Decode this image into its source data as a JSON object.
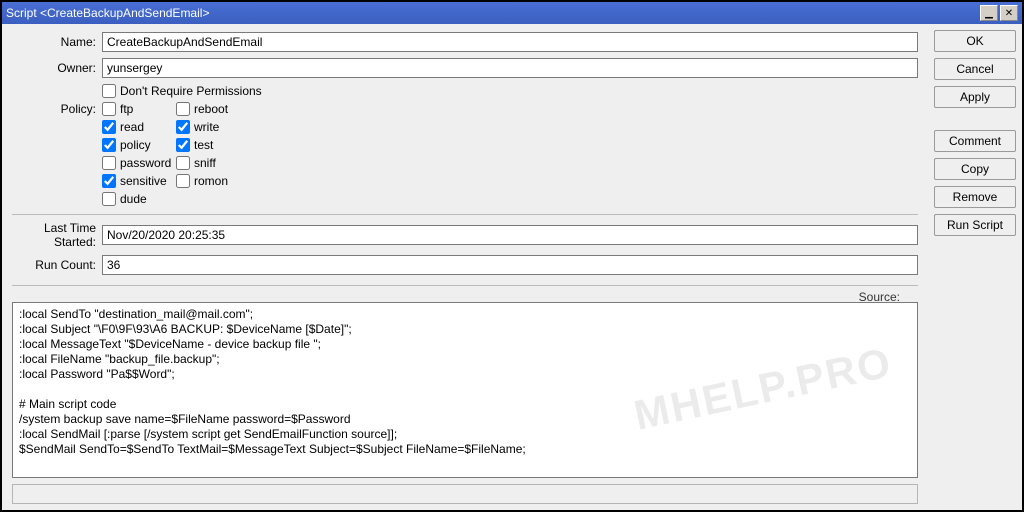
{
  "window": {
    "title": "Script <CreateBackupAndSendEmail>"
  },
  "labels": {
    "name": "Name:",
    "owner": "Owner:",
    "policy": "Policy:",
    "lastTimeStarted": "Last Time Started:",
    "runCount": "Run Count:",
    "source": "Source:",
    "dontRequire": "Don't Require Permissions"
  },
  "fields": {
    "name": "CreateBackupAndSendEmail",
    "owner": "yunsergey",
    "lastTimeStarted": "Nov/20/2020 20:25:35",
    "runCount": "36"
  },
  "policy": {
    "ftp": {
      "label": "ftp",
      "checked": false
    },
    "reboot": {
      "label": "reboot",
      "checked": false
    },
    "read": {
      "label": "read",
      "checked": true
    },
    "write": {
      "label": "write",
      "checked": true
    },
    "policy": {
      "label": "policy",
      "checked": true
    },
    "test": {
      "label": "test",
      "checked": true
    },
    "password": {
      "label": "password",
      "checked": false
    },
    "sniff": {
      "label": "sniff",
      "checked": false
    },
    "sensitive": {
      "label": "sensitive",
      "checked": true
    },
    "romon": {
      "label": "romon",
      "checked": false
    },
    "dude": {
      "label": "dude",
      "checked": false
    }
  },
  "dontRequire": false,
  "source": ":local SendTo \"destination_mail@mail.com\";\n:local Subject \"\\F0\\9F\\93\\A6 BACKUP: $DeviceName [$Date]\";\n:local MessageText \"$DeviceName - device backup file \";\n:local FileName \"backup_file.backup\";\n:local Password \"Pa$$Word\";\n\n# Main script code\n/system backup save name=$FileName password=$Password\n:local SendMail [:parse [/system script get SendEmailFunction source]];\n$SendMail SendTo=$SendTo TextMail=$MessageText Subject=$Subject FileName=$FileName;",
  "buttons": {
    "ok": "OK",
    "cancel": "Cancel",
    "apply": "Apply",
    "comment": "Comment",
    "copy": "Copy",
    "remove": "Remove",
    "runScript": "Run Script"
  },
  "watermark": "MHELP.PRO"
}
